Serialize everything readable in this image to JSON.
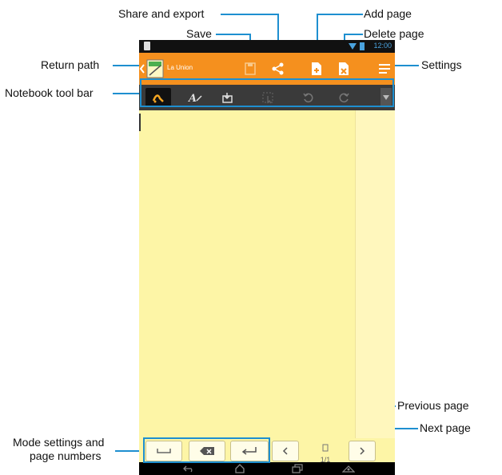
{
  "callouts": {
    "share_export": "Share and export",
    "save": "Save",
    "add_page": "Add page",
    "delete_page": "Delete page",
    "return_path": "Return path",
    "settings": "Settings",
    "notebook_toolbar": "Notebook tool bar",
    "previous_page": "Previous page",
    "next_page": "Next page",
    "mode_settings_line1": "Mode settings and",
    "mode_settings_line2": "page numbers"
  },
  "device": {
    "status_time": "12:00",
    "notebook_title": "La Union",
    "page_indicator": "1/1",
    "accent_color": "#f5901e",
    "page_color": "#fdf5a6",
    "callout_color": "#1e8fd0"
  },
  "icons": {
    "actionbar": [
      "back-chevron-icon",
      "notebook-thumbnail-icon",
      "save-icon",
      "share-icon",
      "add-page-icon",
      "delete-page-icon",
      "settings-menu-icon"
    ],
    "toolbar": [
      "pen-icon",
      "text-mode-icon",
      "insert-icon",
      "select-icon",
      "undo-icon",
      "redo-icon",
      "expand-icon"
    ],
    "bottombar": [
      "space-key-icon",
      "backspace-key-icon",
      "enter-key-icon",
      "prev-page-icon",
      "page-icon",
      "next-page-icon"
    ],
    "navbar": [
      "back-icon",
      "home-icon",
      "recent-apps-icon",
      "screenshot-icon"
    ]
  }
}
